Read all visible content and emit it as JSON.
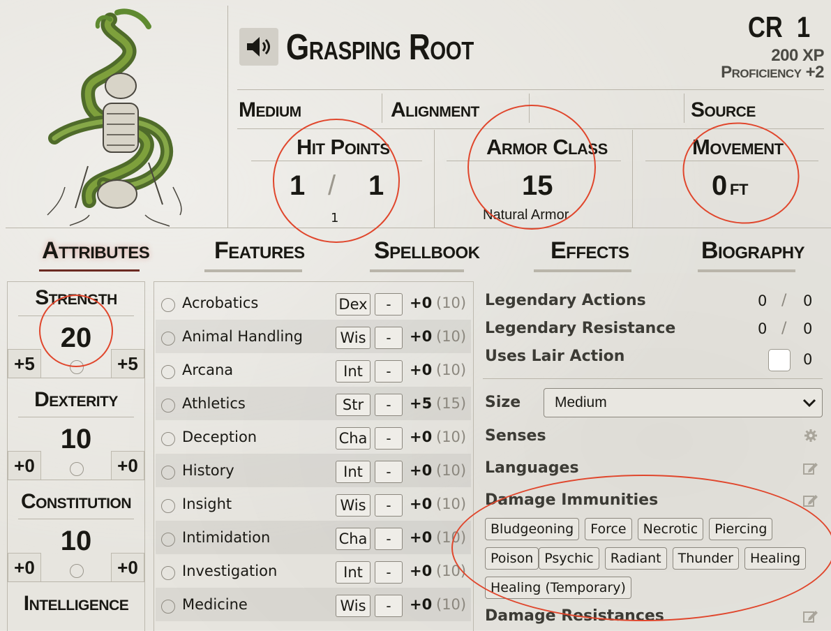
{
  "header": {
    "name": "Grasping Root",
    "cr_label": "CR",
    "cr_value": "1",
    "xp": "200 XP",
    "proficiency": "Proficiency +2"
  },
  "traits": {
    "size": "Medium",
    "alignment": "Alignment",
    "source": "Source"
  },
  "stats": {
    "hp": {
      "label": "Hit Points",
      "value": "1",
      "separator": "/",
      "max": "1",
      "temp": "1"
    },
    "ac": {
      "label": "Armor Class",
      "value": "15",
      "note": "Natural Armor"
    },
    "movement": {
      "label": "Movement",
      "value": "0",
      "unit": "ft"
    }
  },
  "tabs": [
    "Attributes",
    "Features",
    "Spellbook",
    "Effects",
    "Biography"
  ],
  "abilities": [
    {
      "name": "Strength",
      "score": "20",
      "mod": "+5",
      "save": "+5"
    },
    {
      "name": "Dexterity",
      "score": "10",
      "mod": "+0",
      "save": "+0"
    },
    {
      "name": "Constitution",
      "score": "10",
      "mod": "+0",
      "save": "+0"
    },
    {
      "name": "Intelligence",
      "score": "",
      "mod": "",
      "save": ""
    }
  ],
  "skills": [
    {
      "name": "Acrobatics",
      "ability": "Dex",
      "prof": "-",
      "mod": "+0",
      "passive": "(10)"
    },
    {
      "name": "Animal Handling",
      "ability": "Wis",
      "prof": "-",
      "mod": "+0",
      "passive": "(10)"
    },
    {
      "name": "Arcana",
      "ability": "Int",
      "prof": "-",
      "mod": "+0",
      "passive": "(10)"
    },
    {
      "name": "Athletics",
      "ability": "Str",
      "prof": "-",
      "mod": "+5",
      "passive": "(15)"
    },
    {
      "name": "Deception",
      "ability": "Cha",
      "prof": "-",
      "mod": "+0",
      "passive": "(10)"
    },
    {
      "name": "History",
      "ability": "Int",
      "prof": "-",
      "mod": "+0",
      "passive": "(10)"
    },
    {
      "name": "Insight",
      "ability": "Wis",
      "prof": "-",
      "mod": "+0",
      "passive": "(10)"
    },
    {
      "name": "Intimidation",
      "ability": "Cha",
      "prof": "-",
      "mod": "+0",
      "passive": "(10)"
    },
    {
      "name": "Investigation",
      "ability": "Int",
      "prof": "-",
      "mod": "+0",
      "passive": "(10)"
    },
    {
      "name": "Medicine",
      "ability": "Wis",
      "prof": "-",
      "mod": "+0",
      "passive": "(10)"
    }
  ],
  "right": {
    "legendary_actions": {
      "label": "Legendary Actions",
      "value": "0",
      "max": "0"
    },
    "legendary_resistance": {
      "label": "Legendary Resistance",
      "value": "0",
      "max": "0"
    },
    "lair": {
      "label": "Uses Lair Action",
      "value": "0"
    },
    "size": {
      "label": "Size",
      "value": "Medium"
    },
    "senses": "Senses",
    "languages": "Languages",
    "damage_immunities": {
      "label": "Damage Immunities",
      "tags": [
        "Bludgeoning",
        "Force",
        "Necrotic",
        "Piercing",
        "Poison",
        "Psychic",
        "Radiant",
        "Thunder",
        "Healing",
        "Healing (Temporary)"
      ]
    },
    "damage_resistances": "Damage Resistances"
  },
  "colors": {
    "annotation": "#e0462c",
    "tab_active_glow": "#c0463a"
  }
}
